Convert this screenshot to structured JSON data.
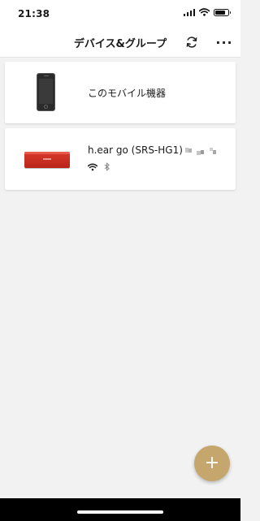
{
  "status_bar": {
    "time": "21:38",
    "icons": [
      "cellular-signal-icon",
      "wifi-icon",
      "battery-icon"
    ]
  },
  "nav": {
    "title": "デバイス&グループ",
    "refresh_icon": "refresh-icon",
    "more_label": "···"
  },
  "devices": [
    {
      "label": "このモバイル機器",
      "icon": "smartphone-icon"
    },
    {
      "label": "h.ear go (SRS-HG1)",
      "icon": "speaker-icon",
      "connection_icons": [
        "wifi-icon",
        "bluetooth-icon"
      ]
    }
  ],
  "fab": {
    "label": "+"
  },
  "colors": {
    "background": "#f2f2f2",
    "card": "#ffffff",
    "fab": "#c5a66c",
    "speaker_red": "#d93a2c"
  }
}
